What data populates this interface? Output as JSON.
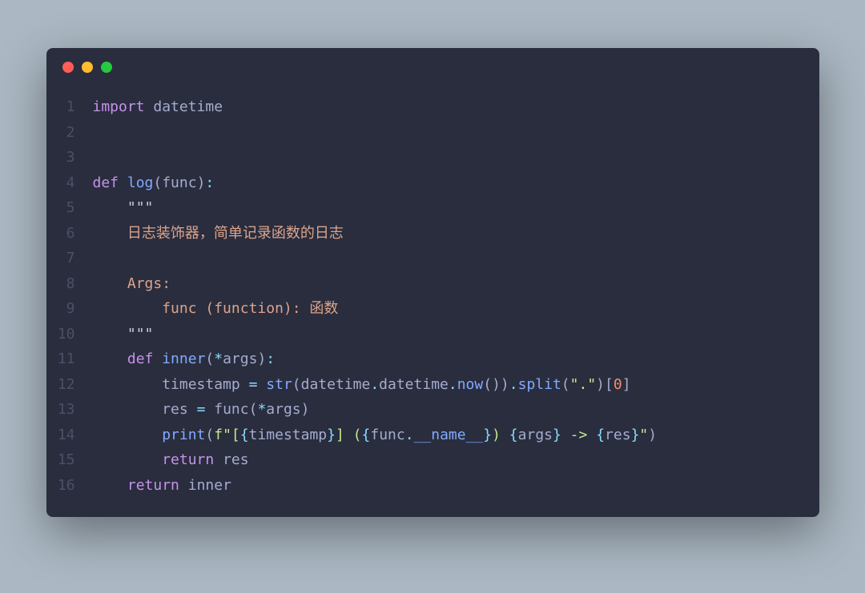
{
  "window": {
    "dots": [
      "red",
      "yellow",
      "green"
    ]
  },
  "code": {
    "lines": [
      {
        "n": 1,
        "tokens": [
          {
            "t": "import",
            "c": "tk-keyword"
          },
          {
            "t": " "
          },
          {
            "t": "datetime",
            "c": ""
          }
        ]
      },
      {
        "n": 2,
        "tokens": []
      },
      {
        "n": 3,
        "tokens": []
      },
      {
        "n": 4,
        "tokens": [
          {
            "t": "def",
            "c": "tk-keyword"
          },
          {
            "t": " "
          },
          {
            "t": "log",
            "c": "tk-def"
          },
          {
            "t": "(",
            "c": "tk-paren"
          },
          {
            "t": "func",
            "c": "tk-param"
          },
          {
            "t": ")",
            "c": "tk-paren"
          },
          {
            "t": ":",
            "c": "tk-op"
          }
        ]
      },
      {
        "n": 5,
        "tokens": [
          {
            "t": "    "
          },
          {
            "t": "\"\"\"",
            "c": "tk-docstr"
          }
        ]
      },
      {
        "n": 6,
        "tokens": [
          {
            "t": "    "
          },
          {
            "t": "日志装饰器，简单记录函数的日志",
            "c": "tk-docstr-cn"
          }
        ]
      },
      {
        "n": 7,
        "tokens": []
      },
      {
        "n": 8,
        "tokens": [
          {
            "t": "    "
          },
          {
            "t": "Args:",
            "c": "tk-docstr-cn"
          }
        ]
      },
      {
        "n": 9,
        "tokens": [
          {
            "t": "        "
          },
          {
            "t": "func (function): 函数",
            "c": "tk-docstr-cn"
          }
        ]
      },
      {
        "n": 10,
        "tokens": [
          {
            "t": "    "
          },
          {
            "t": "\"\"\"",
            "c": "tk-docstr"
          }
        ]
      },
      {
        "n": 11,
        "tokens": [
          {
            "t": "    "
          },
          {
            "t": "def",
            "c": "tk-keyword"
          },
          {
            "t": " "
          },
          {
            "t": "inner",
            "c": "tk-def"
          },
          {
            "t": "(",
            "c": "tk-paren"
          },
          {
            "t": "*",
            "c": "tk-op"
          },
          {
            "t": "args",
            "c": "tk-param"
          },
          {
            "t": ")",
            "c": "tk-paren"
          },
          {
            "t": ":",
            "c": "tk-op"
          }
        ]
      },
      {
        "n": 12,
        "tokens": [
          {
            "t": "        "
          },
          {
            "t": "timestamp ",
            "c": ""
          },
          {
            "t": "=",
            "c": "tk-op"
          },
          {
            "t": " "
          },
          {
            "t": "str",
            "c": "tk-builtin"
          },
          {
            "t": "(",
            "c": "tk-paren"
          },
          {
            "t": "datetime",
            "c": ""
          },
          {
            "t": ".",
            "c": "tk-op"
          },
          {
            "t": "datetime",
            "c": ""
          },
          {
            "t": ".",
            "c": "tk-op"
          },
          {
            "t": "now",
            "c": "tk-def"
          },
          {
            "t": "(",
            "c": "tk-paren"
          },
          {
            "t": ")",
            "c": "tk-paren"
          },
          {
            "t": ")",
            "c": "tk-paren"
          },
          {
            "t": ".",
            "c": "tk-op"
          },
          {
            "t": "split",
            "c": "tk-def"
          },
          {
            "t": "(",
            "c": "tk-paren"
          },
          {
            "t": "\".\"",
            "c": "tk-string"
          },
          {
            "t": ")",
            "c": "tk-paren"
          },
          {
            "t": "[",
            "c": "tk-paren"
          },
          {
            "t": "0",
            "c": "tk-number"
          },
          {
            "t": "]",
            "c": "tk-paren"
          }
        ]
      },
      {
        "n": 13,
        "tokens": [
          {
            "t": "        "
          },
          {
            "t": "res ",
            "c": ""
          },
          {
            "t": "=",
            "c": "tk-op"
          },
          {
            "t": " "
          },
          {
            "t": "func",
            "c": ""
          },
          {
            "t": "(",
            "c": "tk-paren"
          },
          {
            "t": "*",
            "c": "tk-op"
          },
          {
            "t": "args",
            "c": ""
          },
          {
            "t": ")",
            "c": "tk-paren"
          }
        ]
      },
      {
        "n": 14,
        "tokens": [
          {
            "t": "        "
          },
          {
            "t": "print",
            "c": "tk-builtin"
          },
          {
            "t": "(",
            "c": "tk-paren"
          },
          {
            "t": "f\"",
            "c": "tk-string"
          },
          {
            "t": "[",
            "c": "tk-string"
          },
          {
            "t": "{",
            "c": "tk-op"
          },
          {
            "t": "timestamp",
            "c": "tk-fstrvar"
          },
          {
            "t": "}",
            "c": "tk-op"
          },
          {
            "t": "] (",
            "c": "tk-string"
          },
          {
            "t": "{",
            "c": "tk-op"
          },
          {
            "t": "func",
            "c": "tk-fstrvar"
          },
          {
            "t": ".",
            "c": "tk-op"
          },
          {
            "t": "__name__",
            "c": "tk-dunder"
          },
          {
            "t": "}",
            "c": "tk-op"
          },
          {
            "t": ") ",
            "c": "tk-string"
          },
          {
            "t": "{",
            "c": "tk-op"
          },
          {
            "t": "args",
            "c": "tk-fstrvar"
          },
          {
            "t": "}",
            "c": "tk-op"
          },
          {
            "t": " -> ",
            "c": "tk-string"
          },
          {
            "t": "{",
            "c": "tk-op"
          },
          {
            "t": "res",
            "c": "tk-fstrvar"
          },
          {
            "t": "}",
            "c": "tk-op"
          },
          {
            "t": "\"",
            "c": "tk-string"
          },
          {
            "t": ")",
            "c": "tk-paren"
          }
        ]
      },
      {
        "n": 15,
        "tokens": [
          {
            "t": "        "
          },
          {
            "t": "return",
            "c": "tk-keyword"
          },
          {
            "t": " "
          },
          {
            "t": "res",
            "c": ""
          }
        ]
      },
      {
        "n": 16,
        "tokens": [
          {
            "t": "    "
          },
          {
            "t": "return",
            "c": "tk-keyword"
          },
          {
            "t": " "
          },
          {
            "t": "inner",
            "c": ""
          }
        ]
      }
    ]
  }
}
